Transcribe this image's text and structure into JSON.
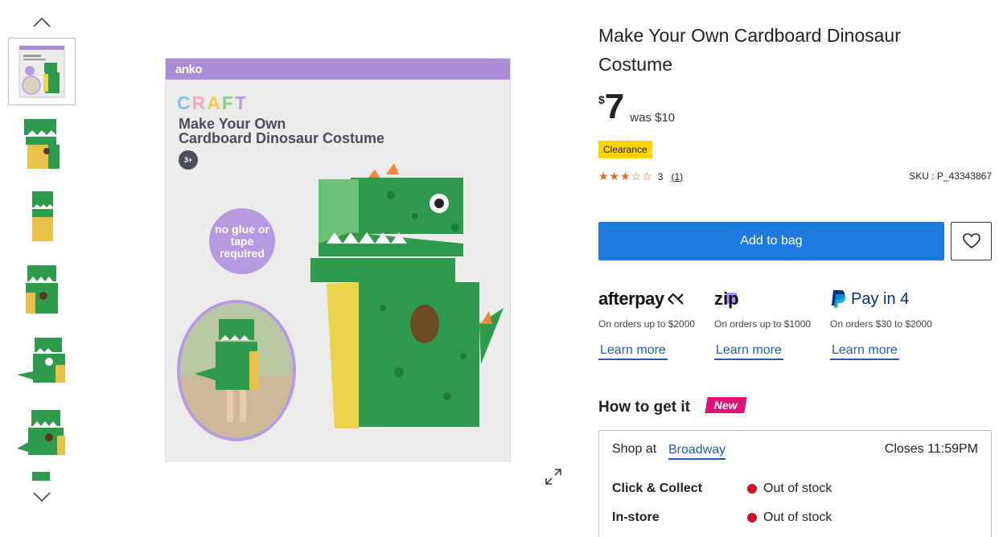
{
  "gallery": {
    "thumbnails": [
      {
        "alt": "box"
      },
      {
        "alt": "front"
      },
      {
        "alt": "side"
      },
      {
        "alt": "angle"
      },
      {
        "alt": "side-left"
      },
      {
        "alt": "angle-2"
      }
    ]
  },
  "main_image": {
    "brand": "anko",
    "craft": [
      "C",
      "R",
      "A",
      "F",
      "T"
    ],
    "box_title_line1": "Make Your Own",
    "box_title_line2": "Cardboard Dinosaur Costume",
    "age": "3+",
    "glue_badge": "no glue or tape required"
  },
  "product": {
    "title": "Make Your Own Cardboard Dinosaur Costume",
    "currency_symbol": "$",
    "price": "7",
    "was": "was $10",
    "badge": "Clearance",
    "stars": "★★★☆☆",
    "rating": "3",
    "review_count": "(1)",
    "sku": "SKU : P_43343867"
  },
  "actions": {
    "add_to_bag": "Add to bag"
  },
  "payments": [
    {
      "name": "afterpay",
      "desc": "On orders up to $2000",
      "learn": "Learn more"
    },
    {
      "name": "zip",
      "desc": "On orders up to $1000",
      "learn": "Learn more"
    },
    {
      "name": "Pay in 4",
      "desc": "On orders $30 to $2000",
      "learn": "Learn more"
    }
  ],
  "fulfilment": {
    "title": "How to get it",
    "new_badge": "New",
    "shop_at": "Shop at",
    "store": "Broadway",
    "closes": "Closes 11:59PM",
    "options": [
      {
        "label": "Click & Collect",
        "status": "Out of stock"
      },
      {
        "label": "In-store",
        "status": "Out of stock"
      }
    ]
  },
  "colors": {
    "primary": "#1f7ae0",
    "link": "#1f5bc2",
    "clearance": "#ffd400",
    "new_badge": "#e0127a",
    "out_of_stock": "#d0102a",
    "star": "#e06a1b"
  }
}
